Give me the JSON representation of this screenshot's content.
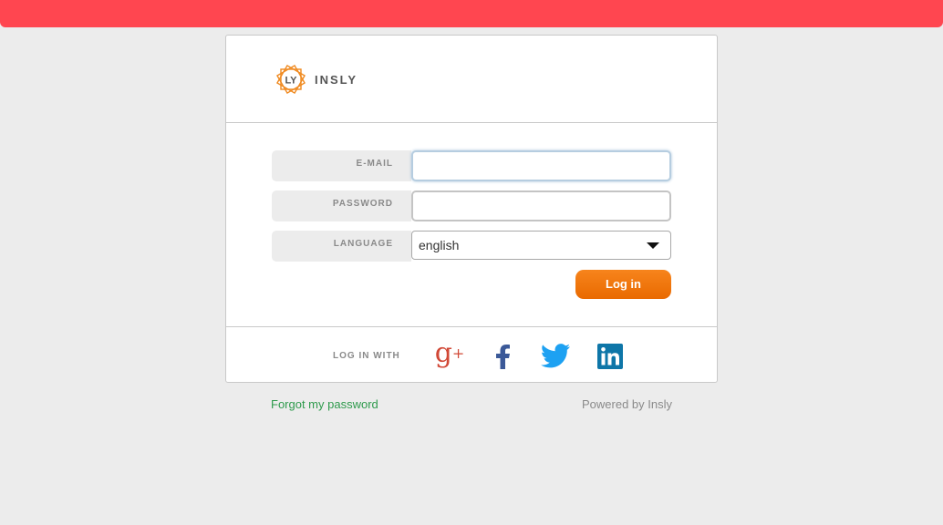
{
  "colors": {
    "top_bar": "#ff4650",
    "accent_orange": "#f07a10",
    "link_green": "#2e9a4c"
  },
  "brand": {
    "logo_icon": "insly-logo-icon",
    "name": "INSLY"
  },
  "form": {
    "email": {
      "label": "E-MAIL",
      "value": "",
      "placeholder": ""
    },
    "password": {
      "label": "PASSWORD",
      "value": "",
      "placeholder": ""
    },
    "language": {
      "label": "LANGUAGE",
      "selected": "english"
    },
    "login_label": "Log in"
  },
  "social": {
    "label": "LOG IN WITH",
    "providers": [
      {
        "name": "Google+",
        "icon": "google-plus-icon",
        "color": "#d14836"
      },
      {
        "name": "Facebook",
        "icon": "facebook-icon",
        "color": "#3b5998"
      },
      {
        "name": "Twitter",
        "icon": "twitter-icon",
        "color": "#1da1f2"
      },
      {
        "name": "LinkedIn",
        "icon": "linkedin-icon",
        "color": "#0e76a8"
      }
    ]
  },
  "footer": {
    "forgot_password": "Forgot my password",
    "powered_by": "Powered by Insly"
  }
}
